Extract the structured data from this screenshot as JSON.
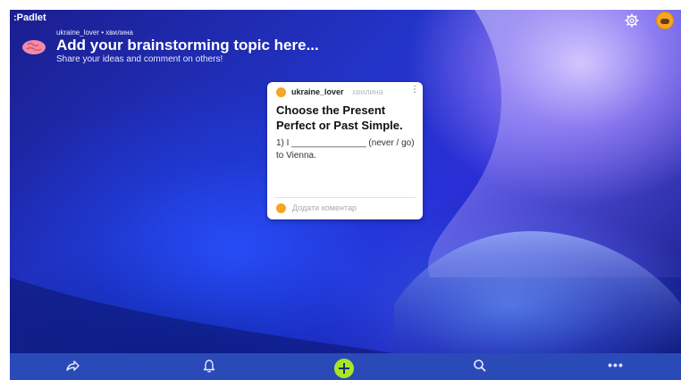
{
  "app": {
    "logo": ":Padlet"
  },
  "header": {
    "author_line": "ukraine_lover • хвилина",
    "title": "Add your brainstorming topic here...",
    "subtitle": "Share your ideas and comment on others!",
    "emoji_icon": "brain-icon"
  },
  "top_right": {
    "settings_icon": "gear-icon",
    "avatar_icon": "user-avatar"
  },
  "post": {
    "author": "ukraine_lover",
    "time": "хвилина",
    "menu": "⋮",
    "title": "Choose the Present Perfect or Past Simple.",
    "body": "1) I _______________ (never / go) to Vienna.",
    "comment_placeholder": "Додати коментар"
  },
  "bottom_bar": {
    "items": [
      "share-icon",
      "bell-icon",
      "add-post-button",
      "search-icon",
      "more-icon"
    ],
    "more_label": "•••",
    "accent": "#a5e52a"
  },
  "colors": {
    "bar": "#2a4ab8",
    "background_dark": "#1b1e8f"
  }
}
